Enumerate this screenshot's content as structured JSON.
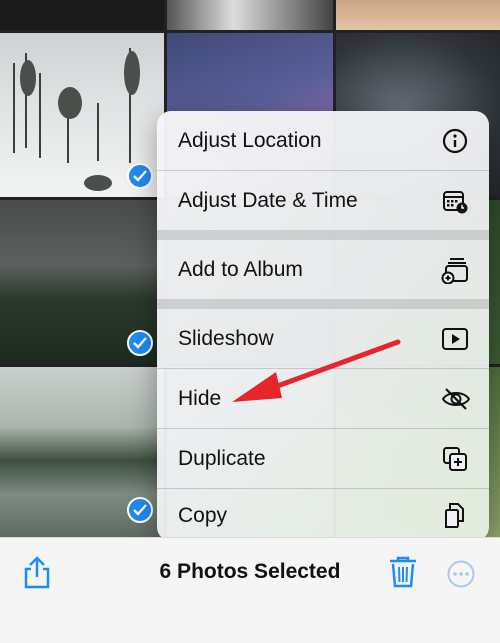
{
  "menu": {
    "items": [
      {
        "label": "Adjust Location",
        "icon": "info-circle-icon"
      },
      {
        "label": "Adjust Date & Time",
        "icon": "calendar-clock-icon"
      },
      {
        "label": "Add to Album",
        "icon": "add-album-icon"
      },
      {
        "label": "Slideshow",
        "icon": "play-icon"
      },
      {
        "label": "Hide",
        "icon": "eye-slash-icon"
      },
      {
        "label": "Duplicate",
        "icon": "duplicate-icon"
      },
      {
        "label": "Copy",
        "icon": "copy-icon"
      }
    ]
  },
  "toolbar": {
    "title": "6 Photos Selected",
    "share_icon": "share-icon",
    "delete_icon": "trash-icon",
    "more_icon": "ellipsis-circle-icon"
  },
  "colors": {
    "accent": "#1f8cf5",
    "annotation_arrow": "#e8242c"
  }
}
